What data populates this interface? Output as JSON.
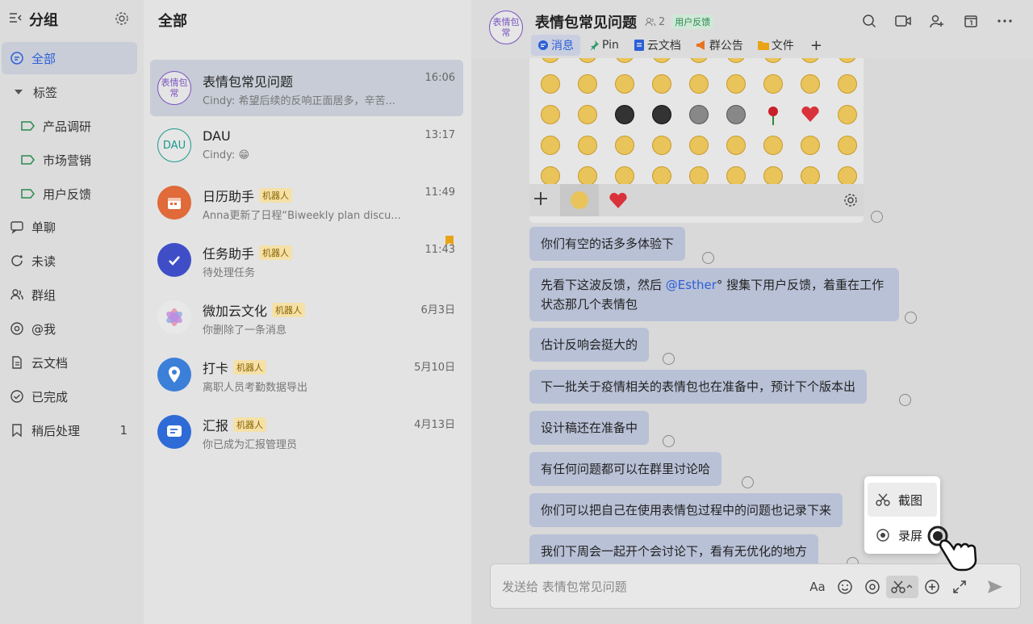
{
  "sidebar": {
    "title": "分组",
    "items": [
      {
        "label": "全部"
      },
      {
        "label": "标签"
      },
      {
        "label": "产品调研"
      },
      {
        "label": "市场营销"
      },
      {
        "label": "用户反馈"
      },
      {
        "label": "单聊"
      },
      {
        "label": "未读"
      },
      {
        "label": "群组"
      },
      {
        "label": "@我"
      },
      {
        "label": "云文档"
      },
      {
        "label": "已完成"
      },
      {
        "label": "稍后处理",
        "count": "1"
      }
    ]
  },
  "conversations": {
    "title": "全部",
    "bot_badge": "机器人",
    "items": [
      {
        "avatar_text": "表情包常",
        "name": "表情包常见问题",
        "time": "16:06",
        "preview": "Cindy: 希望后续的反响正面居多，辛苦..."
      },
      {
        "avatar_text": "DAU",
        "name": "DAU",
        "time": "13:17",
        "preview": "Cindy: 😁"
      },
      {
        "name": "日历助手",
        "time": "11:49",
        "preview": "Anna更新了日程“Biweekly plan discu..."
      },
      {
        "name": "任务助手",
        "time": "11:43",
        "preview": "待处理任务"
      },
      {
        "name": "微加云文化",
        "time": "6月3日",
        "preview": "你删除了一条消息"
      },
      {
        "name": "打卡",
        "time": "5月10日",
        "preview": "离职人员考勤数据导出"
      },
      {
        "name": "汇报",
        "time": "4月13日",
        "preview": "你已成为汇报管理员"
      }
    ]
  },
  "chat": {
    "avatar_text": "表情包常",
    "title": "表情包常见问题",
    "member_count": "2",
    "tag": "用户反馈",
    "tabs": [
      "消息",
      "Pin",
      "云文档",
      "群公告",
      "文件",
      "+"
    ],
    "messages": [
      {
        "text": "你们有空的话多多体验下"
      },
      {
        "pre": "先看下这波反馈，然后 ",
        "mention": "@Esther",
        "post": "° 搜集下用户反馈，着重在工作状态那几个表情包"
      },
      {
        "text": "估计反响会挺大的"
      },
      {
        "text": "下一批关于疫情相关的表情包也在准备中，预计下个版本出"
      },
      {
        "text": "设计稿还在准备中"
      },
      {
        "text": "有任何问题都可以在群里讨论哈"
      },
      {
        "text": "你们可以把自己在使用表情包过程中的问题也记录下来"
      },
      {
        "text": "我们下周会一起开个会讨论下，看有无优化的地方"
      }
    ],
    "composer_placeholder": "发送给 表情包常见问题",
    "composer_font_label": "Aa",
    "popup": {
      "screenshot": "截图",
      "record": "录屏"
    }
  },
  "colors": {
    "accent": "#2d5fd6",
    "bubble": "#b8c1d6",
    "bot_badge": "#f5e1a8",
    "tag": "#cfe8d7"
  }
}
